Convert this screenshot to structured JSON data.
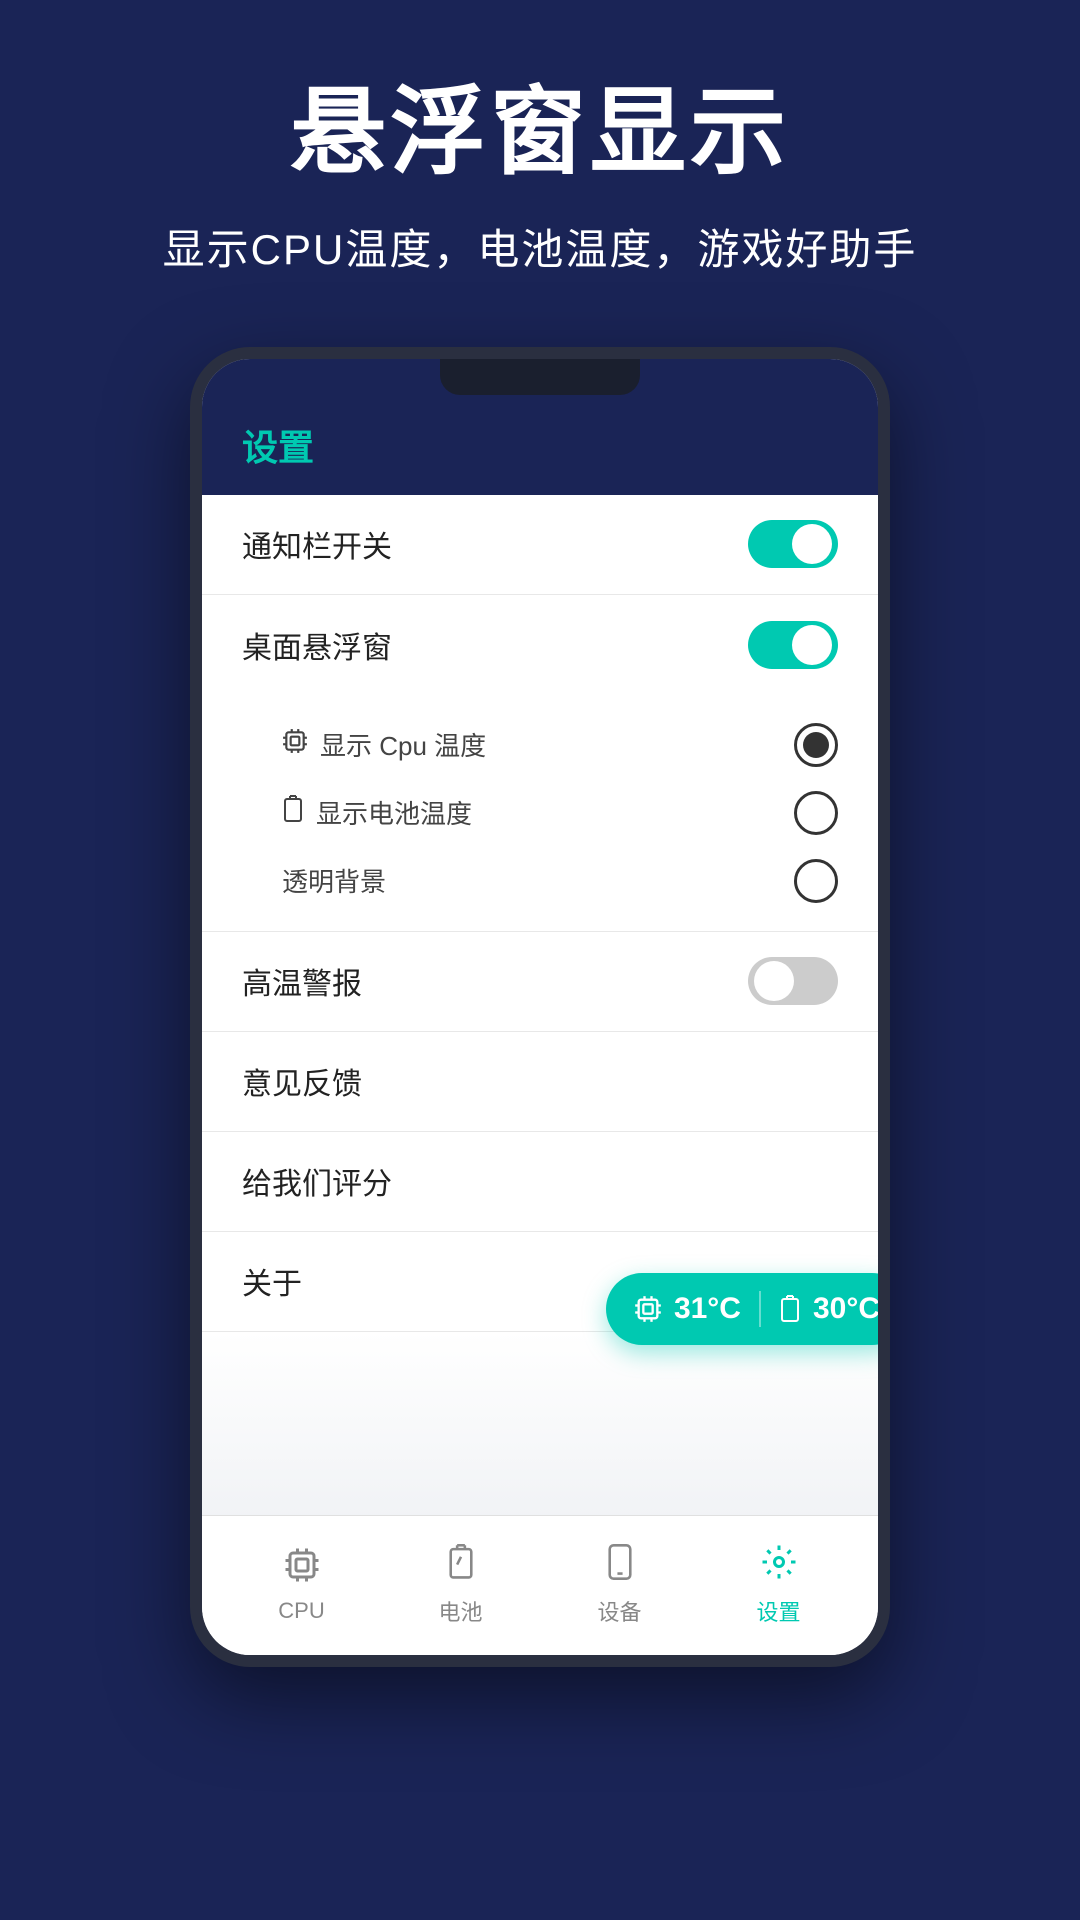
{
  "header": {
    "title": "悬浮窗显示",
    "subtitle": "显示CPU温度，电池温度，游戏好助手"
  },
  "settings": {
    "title": "设置",
    "items": [
      {
        "label": "通知栏开关",
        "type": "toggle",
        "value": true
      },
      {
        "label": "桌面悬浮窗",
        "type": "toggle",
        "value": true
      },
      {
        "label": "高温警报",
        "type": "toggle",
        "value": false
      },
      {
        "label": "意见反馈",
        "type": "none"
      },
      {
        "label": "给我们评分",
        "type": "none"
      },
      {
        "label": "关于",
        "type": "none"
      }
    ],
    "sub_items": [
      {
        "icon": "🔲",
        "label": "显示 Cpu 温度",
        "selected": true
      },
      {
        "icon": "🔋",
        "label": "显示电池温度",
        "selected": false
      },
      {
        "label": "透明背景",
        "selected": false
      }
    ]
  },
  "floating_widget": {
    "cpu_temp": "31°C",
    "battery_temp": "30°C",
    "cpu_icon": "🔲",
    "battery_icon": "🔋"
  },
  "bottom_nav": {
    "items": [
      {
        "label": "CPU",
        "icon": "cpu",
        "active": false
      },
      {
        "label": "电池",
        "icon": "battery",
        "active": false
      },
      {
        "label": "设备",
        "icon": "device",
        "active": false
      },
      {
        "label": "设置",
        "icon": "settings",
        "active": true
      }
    ]
  }
}
